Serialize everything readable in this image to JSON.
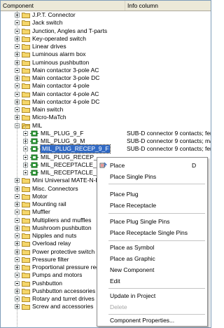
{
  "header": {
    "col1": "Component",
    "col2": "Info column"
  },
  "tree": [
    {
      "label": "J.P.T. Connector",
      "icon": "folder-icon",
      "level": 1,
      "toggle": "plus"
    },
    {
      "label": "Jack switch",
      "icon": "folder-icon",
      "level": 1,
      "toggle": "plus"
    },
    {
      "label": "Junction, Angles and T-parts",
      "icon": "folder-icon",
      "level": 1,
      "toggle": "plus"
    },
    {
      "label": "Key-operated switch",
      "icon": "folder-icon",
      "level": 1,
      "toggle": "plus"
    },
    {
      "label": "Linear drives",
      "icon": "folder-icon",
      "level": 1,
      "toggle": "plus"
    },
    {
      "label": "Luminous alarm box",
      "icon": "folder-icon",
      "level": 1,
      "toggle": "plus"
    },
    {
      "label": "Luminous pushbutton",
      "icon": "folder-icon",
      "level": 1,
      "toggle": "plus"
    },
    {
      "label": "Main contactor 3-pole AC",
      "icon": "folder-icon",
      "level": 1,
      "toggle": "plus"
    },
    {
      "label": "Main contactor 3-pole DC",
      "icon": "folder-icon",
      "level": 1,
      "toggle": "plus"
    },
    {
      "label": "Main contactor 4-pole",
      "icon": "folder-icon",
      "level": 1,
      "toggle": "plus"
    },
    {
      "label": "Main contactor 4-pole AC",
      "icon": "folder-icon",
      "level": 1,
      "toggle": "plus"
    },
    {
      "label": "Main contactor 4-pole DC",
      "icon": "folder-icon",
      "level": 1,
      "toggle": "plus"
    },
    {
      "label": "Main switch",
      "icon": "folder-icon",
      "level": 1,
      "toggle": "plus"
    },
    {
      "label": "Micro-MaTch",
      "icon": "folder-icon",
      "level": 1,
      "toggle": "plus"
    },
    {
      "label": "MIL",
      "icon": "folder-open-icon",
      "level": 1,
      "toggle": "minus"
    },
    {
      "label": "MIL_PLUG_9_F",
      "icon": "plug-icon",
      "level": 2,
      "toggle": "plus",
      "info": "SUB-D connector 9 contacts; fem"
    },
    {
      "label": "MIL_PLUG_9_M",
      "icon": "plug-icon",
      "level": 2,
      "toggle": "plus",
      "info": "SUB-D connector 9 contacts; ma"
    },
    {
      "label": "MIL_PLUG_RECEP_9_F",
      "icon": "plug-icon",
      "level": 2,
      "toggle": "plus",
      "info": "SUB-D connector 9 contacts; fem",
      "selected": true
    },
    {
      "label": "MIL_PLUG_RECEP_",
      "icon": "plug-icon",
      "level": 2,
      "toggle": "plus",
      "info": ""
    },
    {
      "label": "MIL_RECEPTACLE_",
      "icon": "plug-icon",
      "level": 2,
      "toggle": "plus",
      "info": ""
    },
    {
      "label": "MIL_RECEPTACLE_",
      "icon": "plug-icon",
      "level": 2,
      "toggle": "plus",
      "info": ""
    },
    {
      "label": "Mini Universal MATE-N-L",
      "icon": "folder-icon",
      "level": 1,
      "toggle": "plus"
    },
    {
      "label": "Misc. Connectors",
      "icon": "folder-icon",
      "level": 1,
      "toggle": "plus"
    },
    {
      "label": "Motor",
      "icon": "folder-icon",
      "level": 1,
      "toggle": "plus"
    },
    {
      "label": "Mounting rail",
      "icon": "folder-icon",
      "level": 1,
      "toggle": "plus"
    },
    {
      "label": "Muffler",
      "icon": "folder-icon",
      "level": 1,
      "toggle": "plus"
    },
    {
      "label": "Multipliers and muffles",
      "icon": "folder-icon",
      "level": 1,
      "toggle": "plus"
    },
    {
      "label": "Mushroom pushbutton",
      "icon": "folder-icon",
      "level": 1,
      "toggle": "plus"
    },
    {
      "label": "Nipples and nuts",
      "icon": "folder-icon",
      "level": 1,
      "toggle": "plus"
    },
    {
      "label": "Overload relay",
      "icon": "folder-icon",
      "level": 1,
      "toggle": "plus"
    },
    {
      "label": "Power protective switch",
      "icon": "folder-icon",
      "level": 1,
      "toggle": "plus"
    },
    {
      "label": "Pressure filter",
      "icon": "folder-icon",
      "level": 1,
      "toggle": "plus"
    },
    {
      "label": "Proportional pressure regu",
      "icon": "folder-icon",
      "level": 1,
      "toggle": "plus"
    },
    {
      "label": "Pumps and motors",
      "icon": "folder-icon",
      "level": 1,
      "toggle": "plus"
    },
    {
      "label": "Pushbutton",
      "icon": "folder-icon",
      "level": 1,
      "toggle": "plus"
    },
    {
      "label": "Pushbutton accessories",
      "icon": "folder-icon",
      "level": 1,
      "toggle": "plus"
    },
    {
      "label": "Rotary and turret drives",
      "icon": "folder-icon",
      "level": 1,
      "toggle": "plus"
    },
    {
      "label": "Screw and accessories",
      "icon": "folder-icon",
      "level": 1,
      "toggle": "plus"
    }
  ],
  "context_menu": {
    "place": "Place",
    "place_shortcut": "D",
    "place_single_pins": "Place Single Pins",
    "place_plug": "Place Plug",
    "place_receptacle": "Place Receptacle",
    "place_plug_single_pins": "Place Plug Single Pins",
    "place_receptacle_single_pins": "Place Receptacle Single Pins",
    "place_as_symbol": "Place as Symbol",
    "place_as_graphic": "Place as Graphic",
    "new_component": "New Component",
    "edit": "Edit",
    "update_in_project": "Update in Project",
    "delete": "Delete",
    "component_properties": "Component Properties..."
  },
  "colors": {
    "selection": "#316ac5",
    "highlight_box": "#e01818",
    "folder": "#f5d66a"
  }
}
